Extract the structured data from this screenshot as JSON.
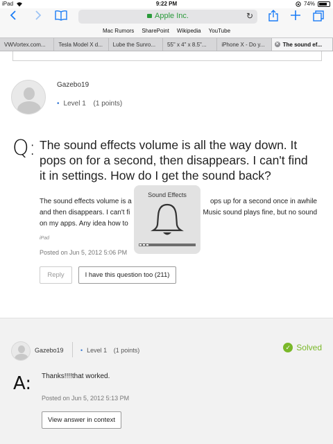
{
  "status_bar": {
    "device": "iPad",
    "time": "9:22 PM",
    "battery": "74%"
  },
  "browser": {
    "url": "Apple Inc.",
    "bookmarks": [
      "Mac Rumors",
      "SharePoint",
      "Wikipedia",
      "YouTube"
    ],
    "tabs": [
      {
        "label": "VWVortex.com..."
      },
      {
        "label": "Tesla Model X d..."
      },
      {
        "label": "Lube the Sunro..."
      },
      {
        "label": "55\" x 4\" x 8.5\"..."
      },
      {
        "label": "iPhone X - Do y..."
      },
      {
        "label": "The sound ef...",
        "active": true
      }
    ]
  },
  "question": {
    "author": "Gazebo19",
    "level": "Level 1",
    "points": "(1 points)",
    "q_letter": "Q:",
    "title": "The sound effects volume is all the way down. It pops on for a second, then disappears. I can't find it in settings. How do I get the sound back?",
    "body_line1": "The sound effects volume is a",
    "body_line1_right": "ops up for a second once in awhile",
    "body_line2": "and then disappears. I can't fi",
    "body_line2_right": "Music sound plays fine, but no sound",
    "body_line3": "on my apps.  Any idea how to",
    "device": "iPad",
    "posted": "Posted on Jun 5, 2012 5:06 PM",
    "reply_label": "Reply",
    "me_too_label": "I have this question too (211)"
  },
  "hud": {
    "title": "Sound Effects",
    "volume_level": 0.2
  },
  "answer": {
    "author": "Gazebo19",
    "level": "Level 1",
    "points": "(1 points)",
    "solved_label": "Solved",
    "a_letter": "A:",
    "body": "Thanks!!!!that worked.",
    "posted": "Posted on Jun 5, 2012 5:13 PM",
    "view_label": "View answer in context"
  },
  "colors": {
    "accent": "#1a7cf6",
    "solved": "#7ab829",
    "secure": "#2a9a3a"
  }
}
